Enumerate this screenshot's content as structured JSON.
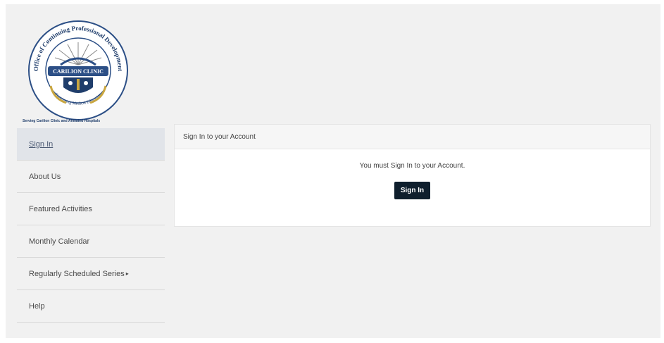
{
  "logo": {
    "ring_text": "Office of Continuing Professional Development",
    "banner_text": "CARILION CLINIC",
    "lower_ring_text": "Continuing Medical Education",
    "tagline": "Serving Carilion Clinic and Affiliated Hospitals",
    "colors": {
      "navy": "#1f3d6b",
      "ring": "#2c4f86",
      "gold": "#c9a640"
    }
  },
  "sidebar": {
    "items": [
      {
        "label": "Sign In",
        "active": true
      },
      {
        "label": "About Us"
      },
      {
        "label": "Featured Activities"
      },
      {
        "label": "Monthly Calendar"
      },
      {
        "label": "Regularly Scheduled Series",
        "caret": "▸"
      },
      {
        "label": "Help"
      }
    ]
  },
  "panel": {
    "title": "Sign In to your Account",
    "message": "You must Sign In to your Account.",
    "button_label": "Sign In"
  },
  "colors": {
    "button_bg": "#0f1f2d",
    "page_bg": "#f1f1f1",
    "active_bg": "#e1e4e9"
  }
}
